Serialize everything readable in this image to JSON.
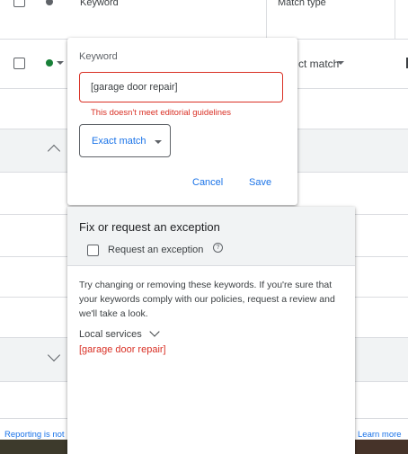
{
  "table": {
    "header": {
      "keyword": "Keyword",
      "match_type": "Match type"
    },
    "row1": {
      "match_type_partial": "ct match"
    },
    "row1_status_color": "#188038"
  },
  "edit_panel": {
    "field_label": "Keyword",
    "keyword_value": "[garage door repair]",
    "error": "This doesn't meet editorial guidelines",
    "match_type": "Exact match",
    "cancel": "Cancel",
    "save": "Save"
  },
  "exception_panel": {
    "title": "Fix or request an exception",
    "checkbox_label": "Request an exception",
    "help_symbol": "?",
    "body": "Try changing or removing these keywords. If you're sure that your keywords comply with our policies, request a review and we'll take a look.",
    "policy": "Local services",
    "flagged_keyword": "[garage door repair]"
  },
  "footer": {
    "left_text": "Reporting is not",
    "right_link": "Learn more"
  },
  "colors": {
    "accent": "#1a73e8",
    "error": "#d93025",
    "status_green": "#188038"
  }
}
